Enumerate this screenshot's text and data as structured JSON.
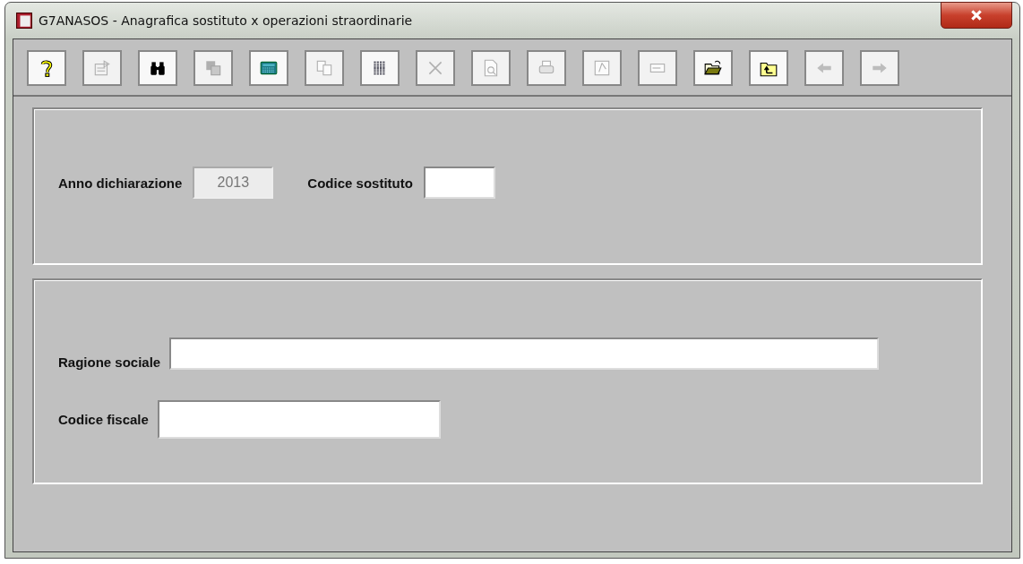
{
  "window": {
    "title": "G7ANASOS - Anagrafica sostituto x operazioni straordinarie"
  },
  "toolbar": [
    {
      "kind": "help",
      "disabled": false
    },
    {
      "kind": "properties",
      "disabled": true
    },
    {
      "kind": "binoculars",
      "disabled": false
    },
    {
      "kind": "tiles",
      "disabled": true
    },
    {
      "kind": "calculator",
      "disabled": false
    },
    {
      "kind": "copy",
      "disabled": true
    },
    {
      "kind": "table",
      "disabled": false
    },
    {
      "kind": "delete",
      "disabled": true
    },
    {
      "kind": "preview",
      "disabled": true
    },
    {
      "kind": "print",
      "disabled": true
    },
    {
      "kind": "pdf",
      "disabled": true
    },
    {
      "kind": "field",
      "disabled": true
    },
    {
      "kind": "openfolder",
      "disabled": false
    },
    {
      "kind": "folderup",
      "disabled": false
    },
    {
      "kind": "back",
      "disabled": true
    },
    {
      "kind": "forward",
      "disabled": true
    }
  ],
  "header_panel": {
    "fields": [
      {
        "label": "Anno dichiarazione",
        "value": "2013",
        "disabled": true
      },
      {
        "label": "Codice sostituto",
        "disabled": false
      }
    ]
  },
  "detail_panel": {
    "fields": [
      {
        "label": "Ragione sociale",
        "disabled": false
      },
      {
        "label": "Codice fiscale",
        "disabled": false
      }
    ]
  }
}
